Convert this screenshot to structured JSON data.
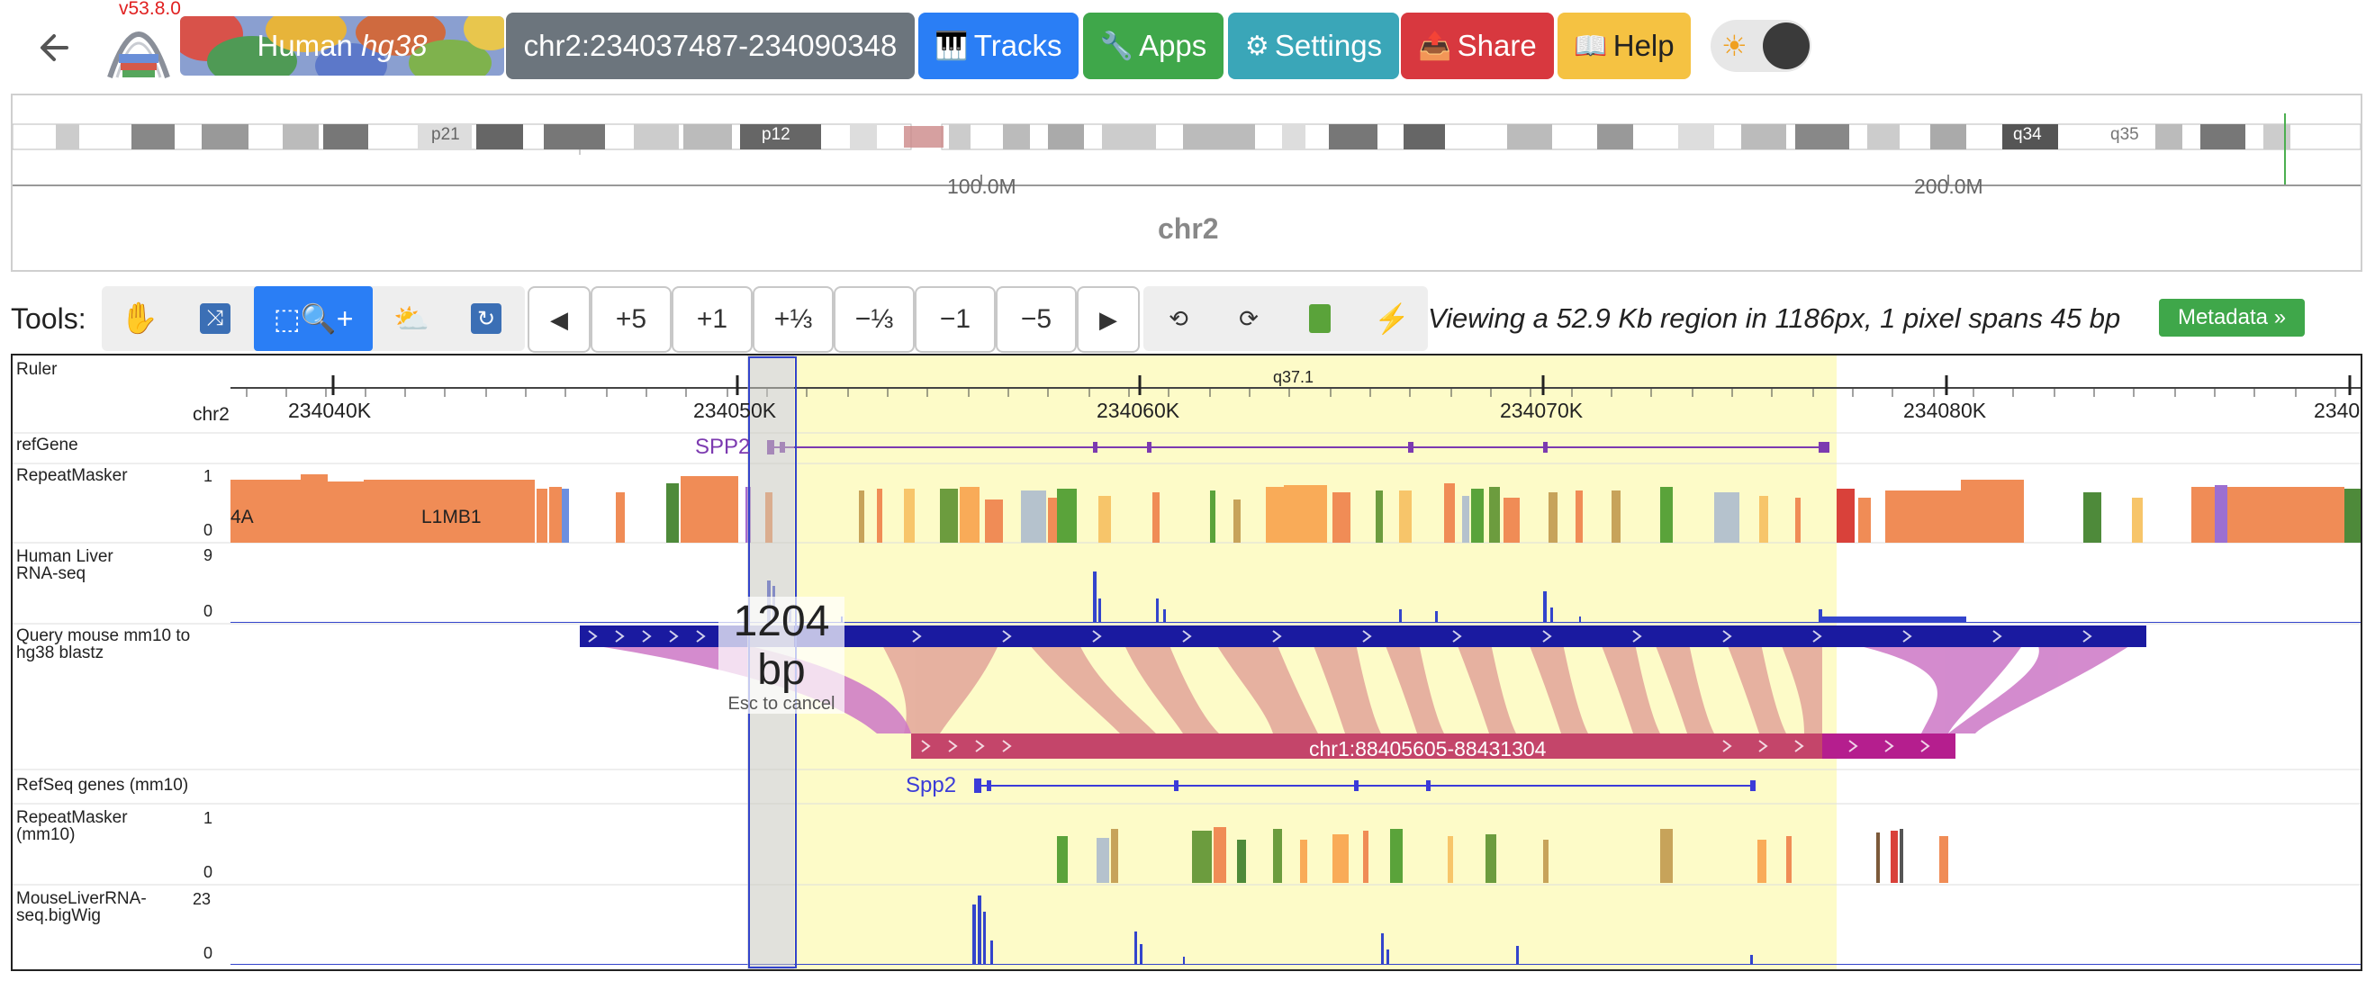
{
  "header": {
    "version": "v53.8.0",
    "genome_label": "Human",
    "genome_assembly": "hg38",
    "locus": "chr2:234037487-234090348",
    "tracks_label": "Tracks",
    "apps_label": "Apps",
    "settings_label": "Settings",
    "share_label": "Share",
    "help_label": "Help",
    "colors": {
      "tracks": "#2a7ef5",
      "apps": "#3fa74a",
      "settings": "#3aa6b8",
      "share": "#d8383f",
      "help": "#f5c242",
      "locus": "#6c757d"
    }
  },
  "ideogram": {
    "chromosome": "chr2",
    "bands": [
      "p21",
      "p12",
      "q34",
      "q35"
    ],
    "scale": [
      "100.0M",
      "200.0M"
    ]
  },
  "tools": {
    "label": "Tools:",
    "zoom_buttons": [
      "+5",
      "+1",
      "+⅓",
      "−⅓",
      "−1",
      "−5"
    ],
    "status": "Viewing a 52.9 Kb region in 1186px, 1 pixel spans 45 bp",
    "metadata_label": "Metadata »"
  },
  "tracks": {
    "ruler": {
      "label": "Ruler",
      "chrom": "chr2",
      "band": "q37.1",
      "ticks": [
        "234040K",
        "234050K",
        "234060K",
        "234070K",
        "234080K",
        "2340"
      ]
    },
    "refgene": {
      "label": "refGene",
      "gene": "SPP2"
    },
    "repeatmasker": {
      "label": "RepeatMasker",
      "max": "1",
      "min": "0",
      "names": [
        "4A",
        "L1MB1"
      ]
    },
    "liver_rna": {
      "label": "Human Liver RNA-seq",
      "max": "9",
      "min": "0"
    },
    "query_mm10": {
      "label": "Query mouse mm10 to hg38 blastz",
      "target_region": "chr1:88405605-88431304"
    },
    "refseq_mm10": {
      "label": "RefSeq genes (mm10)",
      "gene": "Spp2"
    },
    "repeatmasker_mm10": {
      "label": "RepeatMasker (mm10)",
      "max": "1",
      "min": "0"
    },
    "mouse_liver_rna": {
      "label": "MouseLiverRNA-seq.bigWig",
      "max": "23",
      "min": "0"
    }
  },
  "selection": {
    "size_value": "1204",
    "size_unit": "bp",
    "hint": "Esc to cancel"
  }
}
